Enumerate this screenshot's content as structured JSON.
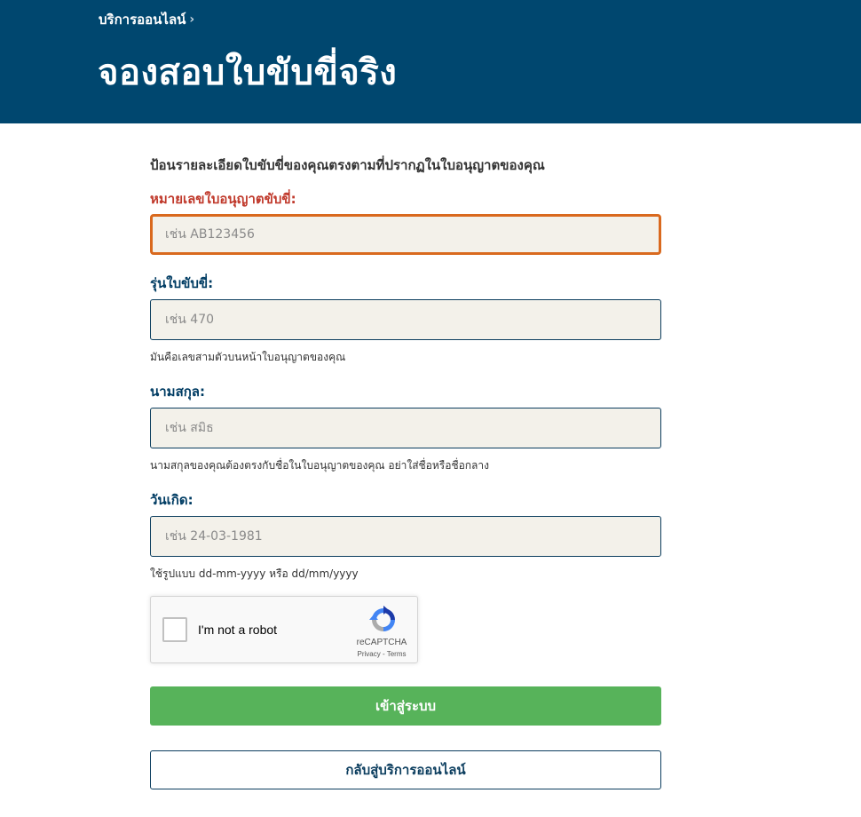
{
  "header": {
    "breadcrumb": "บริการออนไลน์",
    "breadcrumb_separator": "›",
    "title": "จองสอบใบขับขี่จริง",
    "background_color": "#00476f"
  },
  "form": {
    "intro": "ป้อนรายละเอียดใบขับขี่ของคุณตรงตามที่ปรากฏในใบอนุญาตของคุณ",
    "fields": [
      {
        "label": "หมายเลขใบอนุญาตขับขี่:",
        "placeholder": "เช่น AB123456",
        "value": "",
        "state": "focused-error"
      },
      {
        "label": "รุ่นใบขับขี่:",
        "placeholder": "เช่น 470",
        "value": "",
        "help": "มันคือเลขสามตัวบนหน้าใบอนุญาตของคุณ"
      },
      {
        "label": "นามสกุล:",
        "placeholder": "เช่น สมิธ",
        "value": "",
        "help": "นามสกุลของคุณต้องตรงกับชื่อในใบอนุญาตของคุณ อย่าใส่ชื่อหรือชื่อกลาง"
      },
      {
        "label": "วันเกิด:",
        "placeholder": "เช่น 24-03-1981",
        "value": "",
        "help": "ใช้รูปแบบ dd-mm-yyyy หรือ dd/mm/yyyy"
      }
    ],
    "recaptcha": {
      "label": "I'm not a robot",
      "brand": "reCAPTCHA",
      "links": "Privacy - Terms",
      "checked": false,
      "icon": "recaptcha-logo-icon"
    },
    "submit_label": "เข้าสู่ระบบ",
    "back_label": "กลับสู่บริการออนไลน์",
    "colors": {
      "submit": "#57b35a",
      "error": "#c0392b",
      "focus_border": "#d9691e",
      "label": "#003c63",
      "input_bg": "#f3f1ea"
    }
  }
}
